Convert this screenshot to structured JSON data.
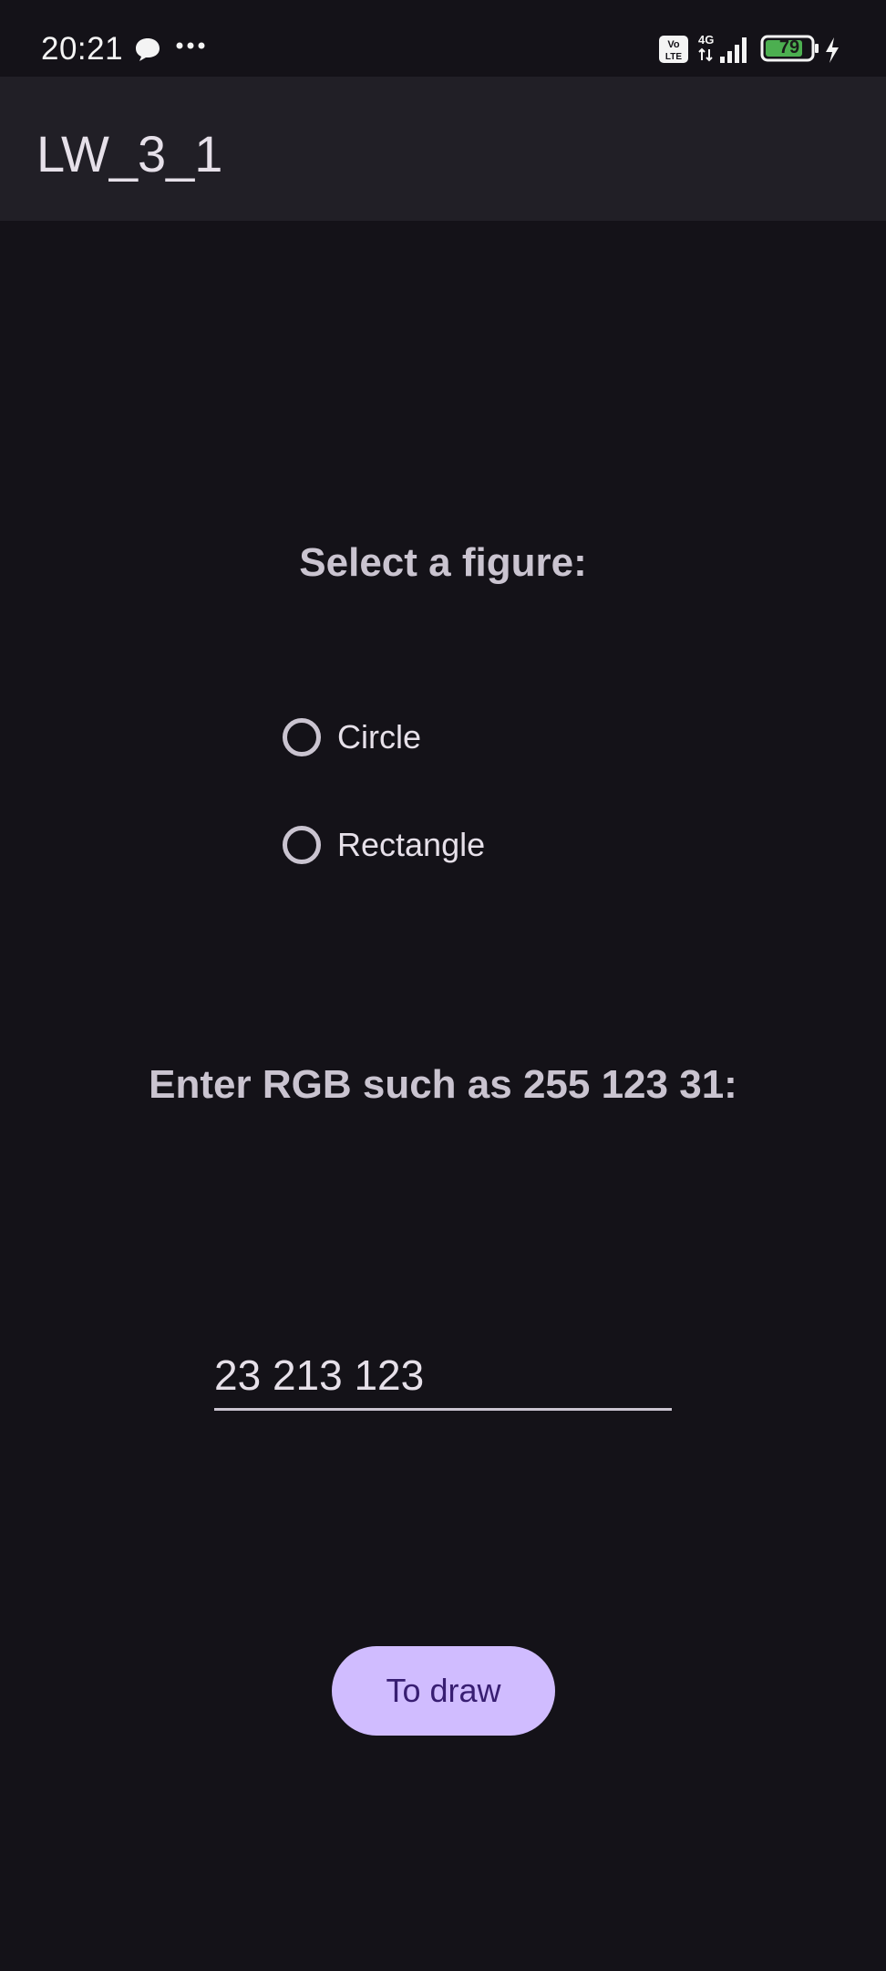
{
  "status_bar": {
    "time": "20:21",
    "network": "4G",
    "volte_label": "Vo LTE",
    "battery_percent": "79",
    "icons": [
      "chat-bubble-icon",
      "more-dots-icon",
      "volte-icon",
      "signal-icon",
      "battery-icon",
      "charging-icon"
    ]
  },
  "app_bar": {
    "title": "LW_3_1"
  },
  "figure_section": {
    "heading": "Select a figure:",
    "options": [
      {
        "label": "Circle",
        "selected": false
      },
      {
        "label": "Rectangle",
        "selected": false
      }
    ]
  },
  "rgb_section": {
    "heading": "Enter RGB such as 255 123 31:",
    "input_value": "23 213 123"
  },
  "draw_button": {
    "label": "To draw"
  },
  "colors": {
    "background": "#141218",
    "app_bar": "#211f26",
    "primary_button": "#d0bcff",
    "button_text": "#381e72",
    "battery_fill": "#4caf50"
  }
}
